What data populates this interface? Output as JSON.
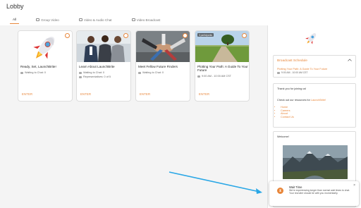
{
  "header": {
    "title": "Lobby",
    "tabs": [
      {
        "label": "All"
      },
      {
        "label": "Group Video"
      },
      {
        "label": "Video & Audio Chat"
      },
      {
        "label": "Video Broadcast"
      }
    ]
  },
  "cards": [
    {
      "title": "Ready, Set, LaunchBrite!",
      "waiting": "Waiting to Chat: 0",
      "enter": "ENTER"
    },
    {
      "title": "Learn About LaunchBrite",
      "waiting": "Waiting to Chat: 0",
      "reps": "Representatives: 0 of 5",
      "enter": "ENTER"
    },
    {
      "title": "Meet Fellow Future Finders",
      "waiting": "Waiting to Chat: 0",
      "enter": "ENTER"
    },
    {
      "title": "Plotting Your Path: A Guide To Your Future",
      "badge": "0 participants",
      "time": "9:00 AM - 10:00 AM CST",
      "enter": "ENTER"
    }
  ],
  "sidebar": {
    "schedule": {
      "heading": "Broadcast Schedule",
      "link": "Plotting Your Path: A Guide To Your Future",
      "time": "9:00 AM - 10:00 AM CST"
    },
    "resources": {
      "thanks": "Thank you for joining us!",
      "intro": "Check out our resources for",
      "brand": "LaunchBrite!",
      "links": [
        "Home",
        "Careers",
        "About",
        "Contact Us"
      ]
    },
    "welcome": {
      "heading": "Welcome!"
    }
  },
  "toast": {
    "title": "Wait Time",
    "message": "We're experiencing longer than normal wait times to chat. Your recruiter should be with you momentarily."
  },
  "colors": {
    "accent": "#e8863a",
    "arrow": "#2aa7e6"
  }
}
